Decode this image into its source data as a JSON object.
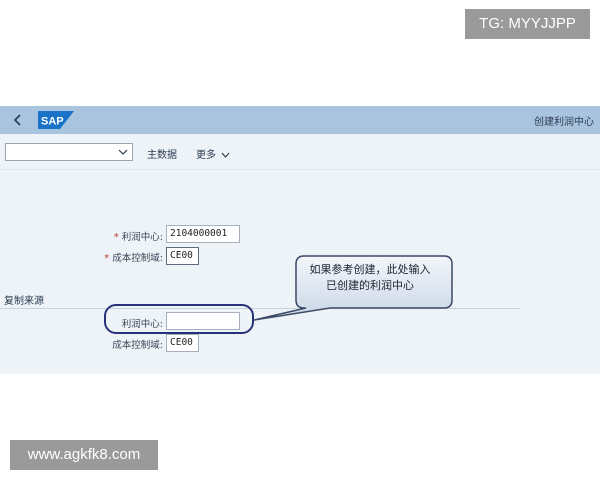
{
  "overlay": {
    "tg_handle": "TG: MYYJJPP",
    "website": "www.agkfk8.com"
  },
  "shell": {
    "logo_text": "SAP",
    "app_title": "创建利润中心",
    "back_icon": "chevron-left-icon"
  },
  "toolbar": {
    "variant_value": "",
    "master_data_label": "主数据",
    "more_label": "更多"
  },
  "form": {
    "profit_center": {
      "label": "利润中心:",
      "required": "*",
      "value": "2104000001"
    },
    "controlling_area": {
      "label": "成本控制域:",
      "required": "*",
      "value": "CE00"
    }
  },
  "copy_from": {
    "section_title": "复制来源",
    "profit_center": {
      "label": "利润中心:",
      "value": ""
    },
    "controlling_area": {
      "label": "成本控制域:",
      "value": "CE00"
    }
  },
  "annotation": {
    "line1": "如果参考创建，此处输入",
    "line2": "已创建的利润中心"
  },
  "colors": {
    "shell_bar": "#a9c4df",
    "content_bg": "#eef3f8",
    "sap_blue": "#1a73c7",
    "required": "#c0392b",
    "focus_ring": "#27307a"
  }
}
